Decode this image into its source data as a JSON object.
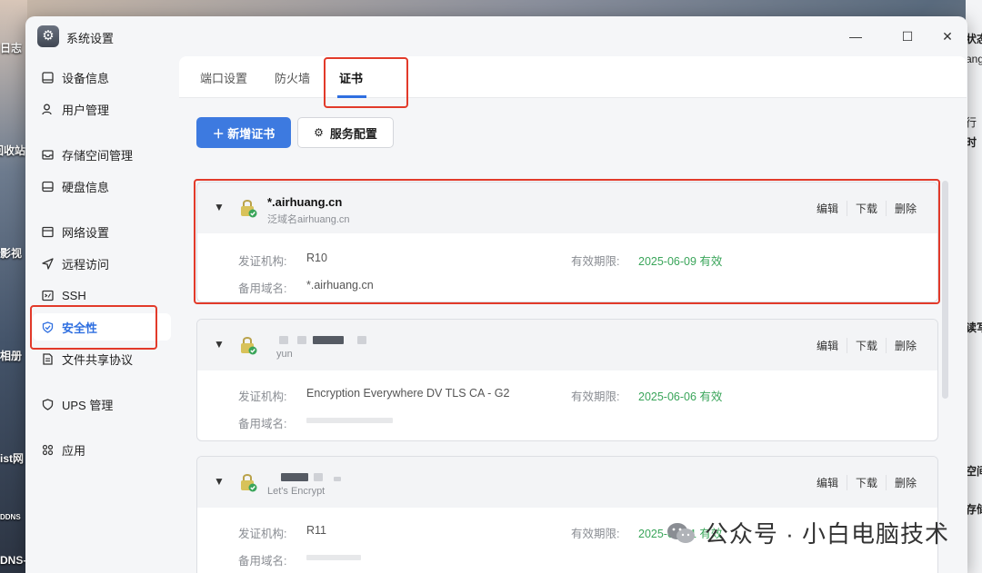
{
  "desktop": {
    "left_labels": [
      "日志",
      "回收站",
      "影视",
      "相册",
      "ist网",
      "DDNS",
      "DNS-C"
    ],
    "right_labels": [
      "状态",
      "ang",
      "行",
      "时",
      "读写",
      "空间",
      "存储"
    ]
  },
  "window": {
    "title": "系统设置",
    "icon": "gear-icon",
    "controls": {
      "minimize": "—",
      "maximize": "☐",
      "close": "✕"
    }
  },
  "sidebar": {
    "items": [
      {
        "label": "设备信息",
        "icon": "device-icon"
      },
      {
        "label": "用户管理",
        "icon": "user-icon"
      },
      {
        "label": "存储空间管理",
        "icon": "storage-icon"
      },
      {
        "label": "硬盘信息",
        "icon": "disk-icon"
      },
      {
        "label": "网络设置",
        "icon": "network-icon"
      },
      {
        "label": "远程访问",
        "icon": "remote-icon"
      },
      {
        "label": "SSH",
        "icon": "terminal-icon"
      },
      {
        "label": "安全性",
        "icon": "shield-icon",
        "active": true
      },
      {
        "label": "文件共享协议",
        "icon": "file-share-icon"
      },
      {
        "label": "UPS 管理",
        "icon": "ups-icon"
      },
      {
        "label": "应用",
        "icon": "apps-icon"
      }
    ]
  },
  "tabs": [
    {
      "label": "端口设置"
    },
    {
      "label": "防火墙"
    },
    {
      "label": "证书",
      "active": true
    }
  ],
  "toolbar": {
    "add_label": "＋  新增证书",
    "config_label": "服务配置"
  },
  "labels": {
    "issuer": "发证机构:",
    "expiry": "有效期限:",
    "alt_domain": "备用域名:"
  },
  "actions": {
    "edit": "编辑",
    "download": "下载",
    "delete": "删除"
  },
  "certificates": [
    {
      "domain": "*.airhuang.cn",
      "subtitle": "泛域名airhuang.cn",
      "issuer": "R10",
      "expiry": "2025-06-09 有效",
      "alt_domain": "*.airhuang.cn"
    },
    {
      "domain": "",
      "subtitle": "yun",
      "issuer": "Encryption Everywhere DV TLS CA - G2",
      "expiry": "2025-06-06 有效",
      "alt_domain": ""
    },
    {
      "domain": "",
      "subtitle": "Let's Encrypt",
      "issuer": "R11",
      "expiry": "2025-05-31 有效",
      "alt_domain": ""
    }
  ],
  "watermark": "公众号 · 小白电脑技术",
  "colors": {
    "accent": "#3d7ae0",
    "valid": "#3aa55a",
    "highlight": "#e23a2a"
  }
}
